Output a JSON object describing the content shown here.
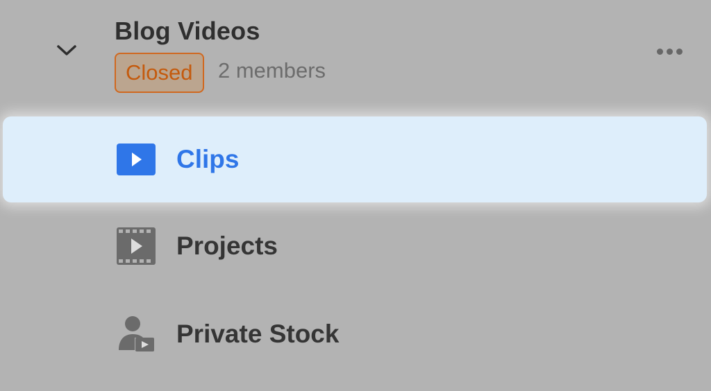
{
  "workspace": {
    "title": "Blog Videos",
    "status_badge": "Closed",
    "members": "2 members"
  },
  "nav": {
    "items": [
      {
        "label": "Clips",
        "icon": "play-square-icon",
        "active": true
      },
      {
        "label": "Projects",
        "icon": "film-strip-icon",
        "active": false
      },
      {
        "label": "Private Stock",
        "icon": "user-video-icon",
        "active": false
      }
    ]
  },
  "colors": {
    "background": "#b3b3b3",
    "active_bg": "#deeefb",
    "accent": "#2f76e8",
    "badge_border": "#d0681f",
    "badge_text": "#c45a0d"
  }
}
